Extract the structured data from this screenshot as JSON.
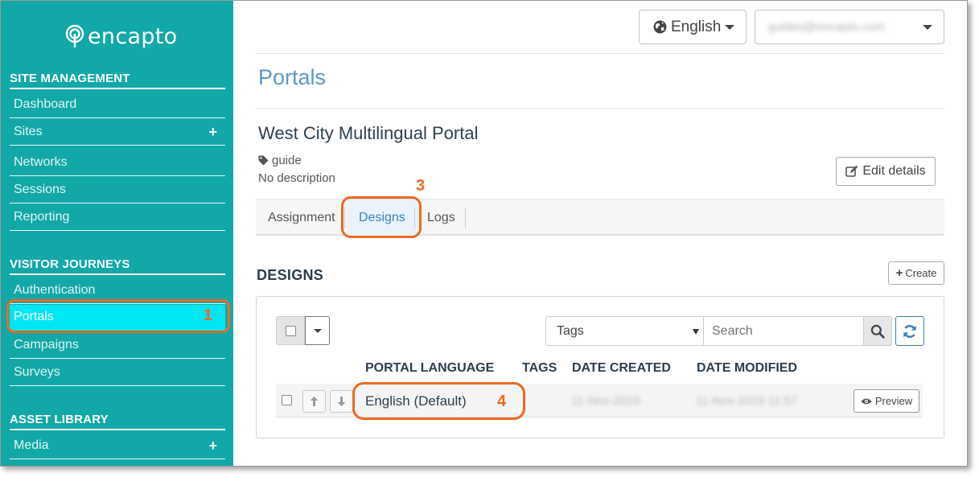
{
  "brand": {
    "logo_text": "encapto"
  },
  "sidebar": {
    "sections": [
      {
        "title": "SITE MANAGEMENT"
      },
      {
        "title": "VISITOR JOURNEYS"
      },
      {
        "title": "ASSET LIBRARY"
      }
    ],
    "items": [
      {
        "label": "Dashboard"
      },
      {
        "label": "Sites",
        "expand": "+"
      },
      {
        "label": "Networks"
      },
      {
        "label": "Sessions"
      },
      {
        "label": "Reporting"
      },
      {
        "label": "Authentication"
      },
      {
        "label": "Portals"
      },
      {
        "label": "Campaigns"
      },
      {
        "label": "Surveys"
      },
      {
        "label": "Media",
        "expand": "+"
      }
    ]
  },
  "topbar": {
    "language": "English",
    "user_email": "guides@encapto.com"
  },
  "page": {
    "title": "Portals",
    "portal_name": "West City Multilingual Portal",
    "tag": "guide",
    "description": "No description",
    "edit_button": "Edit details"
  },
  "tabs": [
    {
      "label": "Assignment"
    },
    {
      "label": "Designs",
      "active": true
    },
    {
      "label": "Logs"
    }
  ],
  "designs": {
    "heading": "DESIGNS",
    "create_button": "Create",
    "tags_select": "Tags",
    "search_placeholder": "Search",
    "columns": [
      "PORTAL LANGUAGE",
      "TAGS",
      "DATE CREATED",
      "DATE MODIFIED"
    ],
    "rows": [
      {
        "language": "English (Default)",
        "tags": "",
        "created": "11-Nov-2019",
        "modified": "11-Nov-2019 11:57",
        "action": "Preview"
      }
    ]
  },
  "annotations": [
    "1",
    "3",
    "4"
  ],
  "colors": {
    "sidebar": "#12a8a7",
    "active_item": "#00e6f2",
    "annotation": "#ee6a22",
    "link_blue": "#3880bd"
  }
}
